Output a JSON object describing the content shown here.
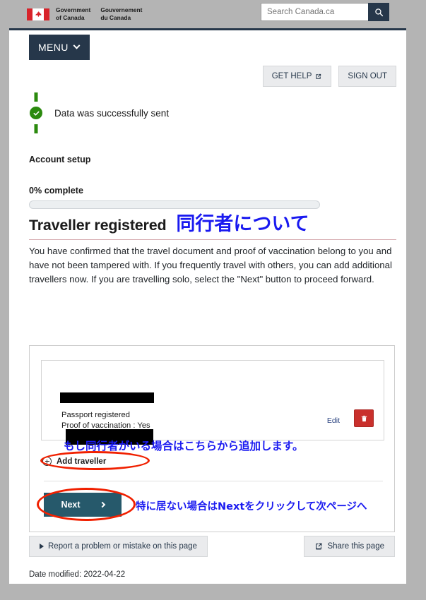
{
  "banner": {
    "flag_icon": "canada-flag-icon",
    "gov_en_line1": "Government",
    "gov_en_line2": "of Canada",
    "gov_fr_line1": "Gouvernement",
    "gov_fr_line2": "du Canada",
    "maple_leaf": "☘"
  },
  "search": {
    "placeholder": "Search Canada.ca",
    "value": "",
    "button_icon": "search-icon"
  },
  "nav": {
    "menu_label": "MENU",
    "menu_chevron_icon": "chevron-down-icon"
  },
  "top_actions": {
    "get_help_label": "GET HELP",
    "get_help_icon": "external-link-icon",
    "sign_out_label": "SIGN OUT"
  },
  "alert": {
    "icon": "success-check-icon",
    "message": "Data was successfully sent",
    "color": "#2b8a0e"
  },
  "progress": {
    "section_label": "Account setup",
    "percent_label": "0% complete",
    "percent_value": 0
  },
  "heading": {
    "title": "Traveller registered",
    "annotation_jp": "同行者について",
    "annotation_color": "#1a1af0"
  },
  "body": {
    "paragraph": "You have confirmed that the travel document and proof of vaccination belong to you and have not been tampered with. If you frequently travel with others, you can add additional travellers now. If you are travelling solo, select the \"Next\" button to proceed forward."
  },
  "traveller_card": {
    "name_redacted": "",
    "passport_status": "Passport registered",
    "vaccination_status": "Proof of vaccination : Yes",
    "detail_redacted": "",
    "edit_label": "Edit",
    "delete_icon": "trash-icon",
    "delete_color": "#c9302c"
  },
  "panel": {
    "jp_note_add": "もし同行者がいる場合はこちらから追加します。",
    "add_traveller_label": "Add traveller",
    "add_traveller_icon": "plus-circle-icon",
    "next_label": "Next",
    "next_chevron_icon": "chevron-right-icon",
    "jp_note_next": "特に居ない場合はNextをクリックして次ページへ",
    "annotation_ellipse_color": "#f02000"
  },
  "footer": {
    "report_label": "Report a problem or mistake on this page",
    "report_icon": "triangle-right-icon",
    "share_label": "Share this page",
    "share_icon": "share-icon",
    "date_modified": "Date modified: 2022-04-22"
  }
}
